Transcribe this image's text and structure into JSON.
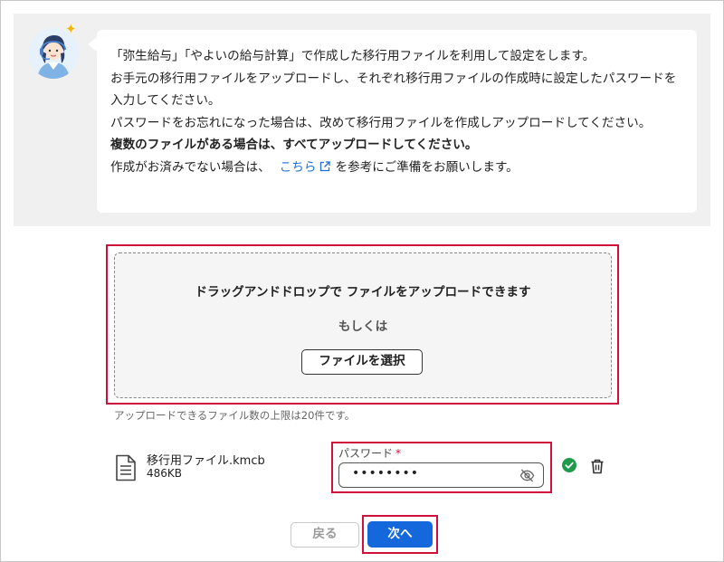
{
  "info": {
    "line1": "「弥生給与」「やよいの給与計算」で作成した移行用ファイルを利用して設定をします。",
    "line2": "お手元の移行用ファイルをアップロードし、それぞれ移行用ファイルの作成時に設定したパスワードを入力してください。",
    "line3": "パスワードをお忘れになった場合は、改めて移行用ファイルを作成しアップロードしてください。",
    "line4_bold": "複数のファイルがある場合は、すべてアップロードしてください。",
    "line5_prefix": "作成がお済みでない場合は、",
    "line5_link": "こちら",
    "line5_suffix": "を参考にご準備をお願いします。"
  },
  "upload": {
    "drop_text": "ドラッグアンドドロップで ファイルをアップロードできます",
    "or_text": "もしくは",
    "select_button": "ファイルを選択",
    "limit_note": "アップロードできるファイル数の上限は20件です。"
  },
  "file": {
    "name": "移行用ファイル.kmcb",
    "size": "486KB",
    "password_label": "パスワード",
    "required_mark": "*",
    "password_value": "••••••••"
  },
  "footer": {
    "back_label": "戻る",
    "next_label": "次へ"
  },
  "colors": {
    "accent": "#1468db",
    "highlight": "#d0103a",
    "success": "#1e9a4a"
  }
}
